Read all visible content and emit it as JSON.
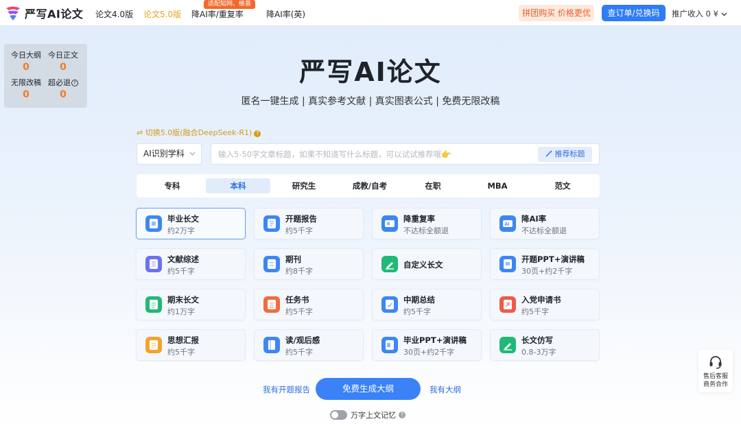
{
  "header": {
    "logo_text": "严写AI论文",
    "nav": [
      {
        "label": "论文4.0版",
        "active": false
      },
      {
        "label": "论文5.0版",
        "active": true
      },
      {
        "label": "降AI率/重复率",
        "active": false,
        "badge": "适配知网、维普"
      },
      {
        "label": "降AI率(英)",
        "active": false
      }
    ],
    "promo_button": "拼团购买 价格更优",
    "order_button": "查订单/兑换码",
    "income": "推广收入 0 ¥"
  },
  "stats": [
    {
      "label": "今日大纲",
      "value": "0"
    },
    {
      "label": "今日正文",
      "value": "0"
    },
    {
      "label": "无限改稿",
      "value": "0"
    },
    {
      "label": "超必退",
      "value": "0"
    }
  ],
  "hero": {
    "title": "严写AI论文",
    "subtitle": "匿名一键生成 | 真实参考文献 | 真实图表公式 | 免费无限改稿"
  },
  "version_switch": "⇌ 切换5.0版(融合DeepSeek-R1)",
  "subject_select": "AI识别学科",
  "title_input": {
    "placeholder": "输入5-50字文章标题，如果不知道写什么标题，可以试试推荐哦👉",
    "value": ""
  },
  "recommend_button": "推荐标题",
  "levels": [
    {
      "label": "专科",
      "active": false
    },
    {
      "label": "本科",
      "active": true
    },
    {
      "label": "研究生",
      "active": false
    },
    {
      "label": "成教/自考",
      "active": false
    },
    {
      "label": "在职",
      "active": false
    },
    {
      "label": "MBA",
      "active": false
    },
    {
      "label": "范文",
      "active": false
    }
  ],
  "cards": [
    {
      "title": "毕业长文",
      "desc": "约2万字",
      "color": "#3d86f5",
      "icon": "document-icon",
      "selected": true
    },
    {
      "title": "开题报告",
      "desc": "约5千字",
      "color": "#3d86f5",
      "icon": "report-icon",
      "selected": false
    },
    {
      "title": "降重复率",
      "desc": "不达标全额退",
      "color": "#3d86f5",
      "icon": "dedupe-icon",
      "selected": false
    },
    {
      "title": "降AI率",
      "desc": "不达标全额退",
      "color": "#3d86f5",
      "icon": "ai-icon",
      "selected": false
    },
    {
      "title": "文献综述",
      "desc": "约5千字",
      "color": "#6a72f0",
      "icon": "review-icon",
      "selected": false
    },
    {
      "title": "期刊",
      "desc": "约8千字",
      "color": "#3d86f5",
      "icon": "journal-icon",
      "selected": false
    },
    {
      "title": "自定义长文",
      "desc": "",
      "color": "#21b978",
      "icon": "pen-icon",
      "selected": false
    },
    {
      "title": "开题PPT+演讲稿",
      "desc": "30页+约2千字",
      "color": "#3d86f5",
      "icon": "slides-icon",
      "selected": false
    },
    {
      "title": "期末长文",
      "desc": "约1万字",
      "color": "#21b978",
      "icon": "final-icon",
      "selected": false
    },
    {
      "title": "任务书",
      "desc": "约5千字",
      "color": "#f26b3c",
      "icon": "task-icon",
      "selected": false
    },
    {
      "title": "中期总结",
      "desc": "约5千字",
      "color": "#3d86f5",
      "icon": "summary-icon",
      "selected": false
    },
    {
      "title": "入党申请书",
      "desc": "约5千字",
      "color": "#ee5a4a",
      "icon": "party-icon",
      "selected": false
    },
    {
      "title": "思想汇报",
      "desc": "约5千字",
      "color": "#f4a22d",
      "icon": "thought-icon",
      "selected": false
    },
    {
      "title": "读/观后感",
      "desc": "约5千字",
      "color": "#3d86f5",
      "icon": "book-icon",
      "selected": false
    },
    {
      "title": "毕业PPT+演讲稿",
      "desc": "30页+约2千字",
      "color": "#3d86f5",
      "icon": "ppt-icon",
      "selected": false
    },
    {
      "title": "长文仿写",
      "desc": "0.8-3万字",
      "color": "#21b978",
      "icon": "imitate-icon",
      "selected": false
    }
  ],
  "actions": {
    "have_report": "我有开题报告",
    "generate": "免费生成大纲",
    "have_outline": "我有大纲"
  },
  "memory_toggle": {
    "label": "万字上文记忆",
    "on": false
  },
  "support": {
    "line1": "售后客服",
    "line2": "商务合作"
  }
}
